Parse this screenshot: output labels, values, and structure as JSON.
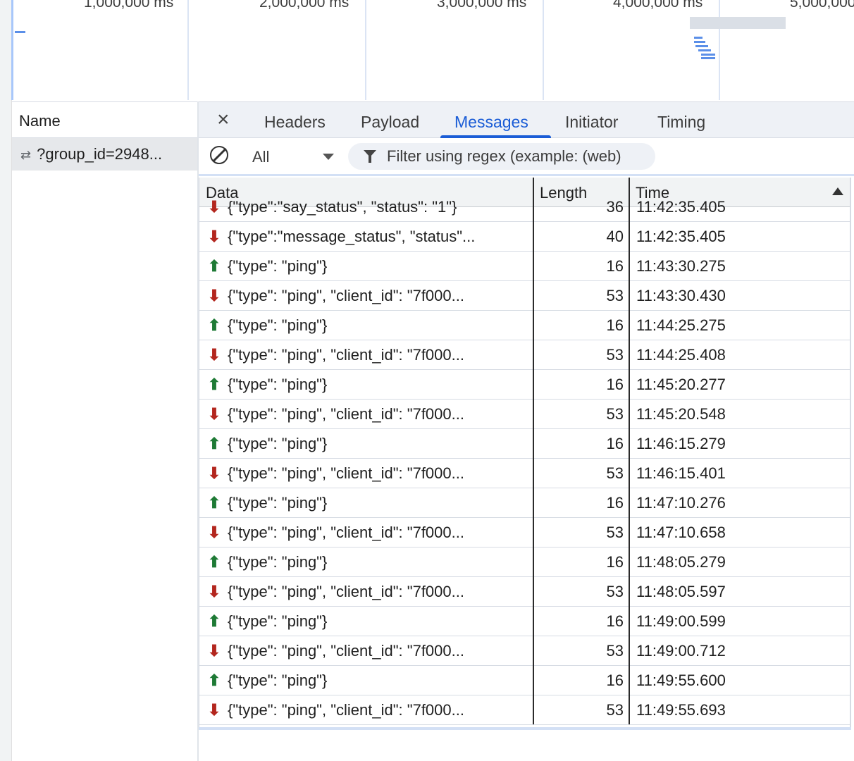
{
  "overview": {
    "labels": [
      "1,000,000 ms",
      "2,000,000 ms",
      "3,000,000 ms",
      "4,000,000 ms",
      "5,000,000 ms"
    ]
  },
  "name_panel": {
    "header": "Name",
    "request": "?group_id=2948..."
  },
  "tabs": {
    "close": "×",
    "items": [
      "Headers",
      "Payload",
      "Messages",
      "Initiator",
      "Timing"
    ],
    "active": "Messages"
  },
  "filter": {
    "type_value": "All",
    "placeholder": "Filter using regex (example: (web)"
  },
  "table": {
    "columns": [
      "Data",
      "Length",
      "Time"
    ],
    "sort_column": "Time",
    "sort_direction": "ascending",
    "rows": [
      {
        "dir": "down",
        "data": "{\"type\":\"say_status\", \"status\": \"1\"}",
        "length": "36",
        "time": "11:42:35.405"
      },
      {
        "dir": "down",
        "data": "{\"type\":\"message_status\", \"status\"...",
        "length": "40",
        "time": "11:42:35.405"
      },
      {
        "dir": "up",
        "data": "{\"type\": \"ping\"}",
        "length": "16",
        "time": "11:43:30.275"
      },
      {
        "dir": "down",
        "data": "{\"type\": \"ping\", \"client_id\": \"7f000...",
        "length": "53",
        "time": "11:43:30.430"
      },
      {
        "dir": "up",
        "data": "{\"type\": \"ping\"}",
        "length": "16",
        "time": "11:44:25.275"
      },
      {
        "dir": "down",
        "data": "{\"type\": \"ping\", \"client_id\": \"7f000...",
        "length": "53",
        "time": "11:44:25.408"
      },
      {
        "dir": "up",
        "data": "{\"type\": \"ping\"}",
        "length": "16",
        "time": "11:45:20.277"
      },
      {
        "dir": "down",
        "data": "{\"type\": \"ping\", \"client_id\": \"7f000...",
        "length": "53",
        "time": "11:45:20.548"
      },
      {
        "dir": "up",
        "data": "{\"type\": \"ping\"}",
        "length": "16",
        "time": "11:46:15.279"
      },
      {
        "dir": "down",
        "data": "{\"type\": \"ping\", \"client_id\": \"7f000...",
        "length": "53",
        "time": "11:46:15.401"
      },
      {
        "dir": "up",
        "data": "{\"type\": \"ping\"}",
        "length": "16",
        "time": "11:47:10.276"
      },
      {
        "dir": "down",
        "data": "{\"type\": \"ping\", \"client_id\": \"7f000...",
        "length": "53",
        "time": "11:47:10.658"
      },
      {
        "dir": "up",
        "data": "{\"type\": \"ping\"}",
        "length": "16",
        "time": "11:48:05.279"
      },
      {
        "dir": "down",
        "data": "{\"type\": \"ping\", \"client_id\": \"7f000...",
        "length": "53",
        "time": "11:48:05.597"
      },
      {
        "dir": "up",
        "data": "{\"type\": \"ping\"}",
        "length": "16",
        "time": "11:49:00.599"
      },
      {
        "dir": "down",
        "data": "{\"type\": \"ping\", \"client_id\": \"7f000...",
        "length": "53",
        "time": "11:49:00.712"
      },
      {
        "dir": "up",
        "data": "{\"type\": \"ping\"}",
        "length": "16",
        "time": "11:49:55.600"
      },
      {
        "dir": "down",
        "data": "{\"type\": \"ping\", \"client_id\": \"7f000...",
        "length": "53",
        "time": "11:49:55.693"
      }
    ]
  },
  "icons": {
    "up": "⬆",
    "down": "⬇",
    "websocket": "⇄"
  },
  "colors": {
    "accent": "#1a5cd6",
    "sent_arrow": "#1e7a35",
    "received_arrow": "#b3261e"
  }
}
